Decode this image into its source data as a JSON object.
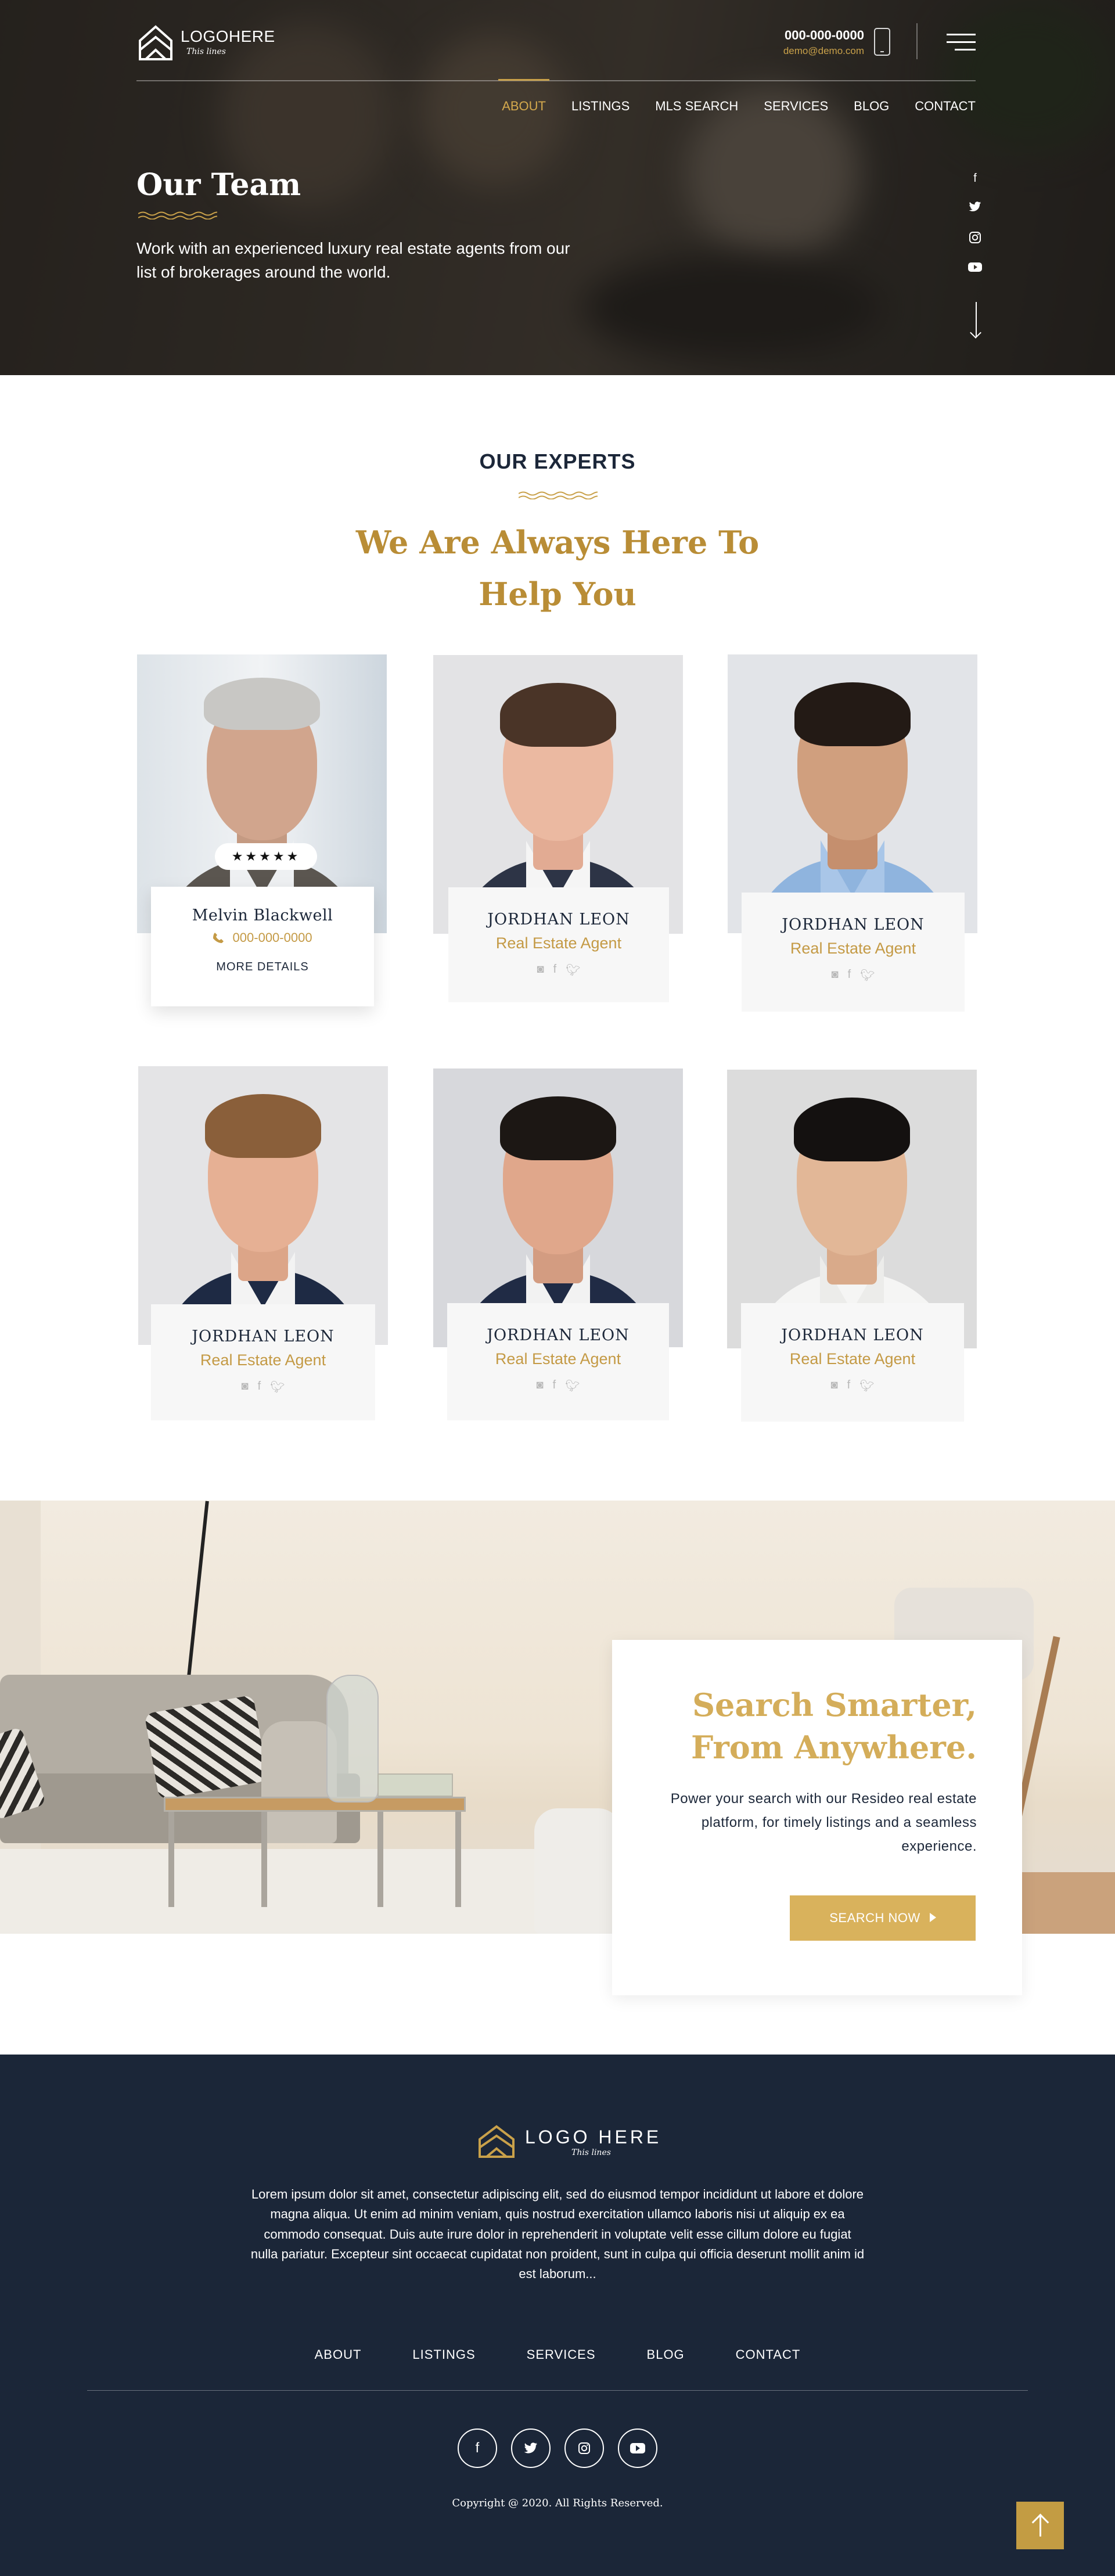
{
  "header": {
    "logo_text": "LOGOHERE",
    "logo_tagline": "This lines",
    "phone": "000-000-0000",
    "email": "demo@demo.com",
    "nav": [
      "ABOUT",
      "LISTINGS",
      "MLS SEARCH",
      "SERVICES",
      "BLOG",
      "CONTACT"
    ],
    "active_nav": "ABOUT"
  },
  "hero": {
    "title": "Our Team",
    "subtitle": "Work with an experienced luxury real estate agents from our list of brokerages around the world.",
    "social": [
      "facebook-icon",
      "twitter-icon",
      "instagram-icon",
      "youtube-icon"
    ]
  },
  "experts": {
    "label": "OUR EXPERTS",
    "title": "We Are Always Here To Help You",
    "featured": {
      "name": "Melvin Blackwell",
      "rating": "★★★★★",
      "phone": "000-000-0000",
      "more": "MORE DETAILS"
    },
    "agents": [
      {
        "name": "JORDHAN LEON",
        "role": "Real Estate Agent"
      },
      {
        "name": "JORDHAN LEON",
        "role": "Real Estate Agent"
      },
      {
        "name": "JORDHAN LEON",
        "role": "Real Estate Agent"
      },
      {
        "name": "JORDHAN LEON",
        "role": "Real Estate Agent"
      },
      {
        "name": "JORDHAN LEON",
        "role": "Real Estate Agent"
      }
    ]
  },
  "search": {
    "title": "Search Smarter, From Anywhere.",
    "description": "Power your search with our Resideo real estate platform, for timely listings and a seamless experience.",
    "button": "SEARCH NOW"
  },
  "footer": {
    "logo_text": "LOGO HERE",
    "logo_tagline": "This lines",
    "description": "Lorem ipsum dolor sit amet, consectetur adipiscing elit, sed do eiusmod tempor incididunt ut labore et dolore magna aliqua. Ut enim ad minim veniam, quis nostrud exercitation ullamco laboris nisi ut aliquip ex ea commodo consequat. Duis aute irure dolor in reprehenderit in voluptate velit esse cillum dolore eu fugiat nulla pariatur. Excepteur sint occaecat cupidatat non proident, sunt in culpa qui officia deserunt mollit anim id est laborum...",
    "nav": [
      "ABOUT",
      "LISTINGS",
      "SERVICES",
      "BLOG",
      "CONTACT"
    ],
    "social": [
      "facebook-icon",
      "twitter-icon",
      "instagram-icon",
      "youtube-icon"
    ],
    "copyright": "Copyright @ 2020. All Rights Reserved."
  },
  "colors": {
    "gold": "#c49a45",
    "navy": "#1b2638"
  }
}
